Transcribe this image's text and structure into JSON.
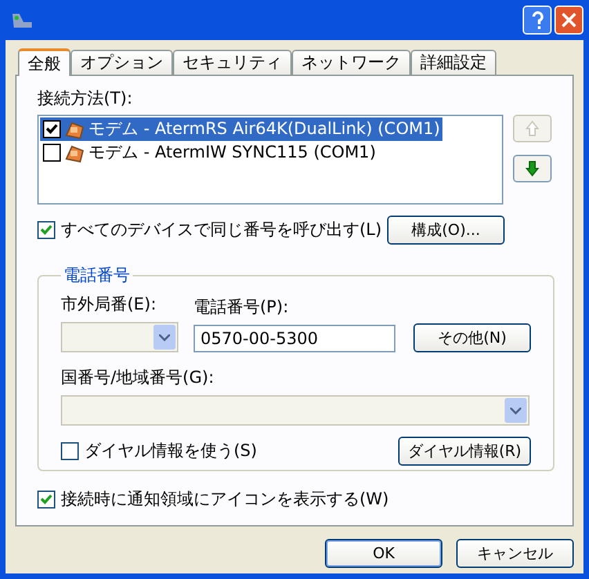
{
  "tabs": [
    {
      "label": "全般",
      "selected": true
    },
    {
      "label": "オプション",
      "selected": false
    },
    {
      "label": "セキュリティ",
      "selected": false
    },
    {
      "label": "ネットワーク",
      "selected": false
    },
    {
      "label": "詳細設定",
      "selected": false
    }
  ],
  "connection": {
    "label": "接続方法(T):",
    "devices": [
      {
        "name": "モデム - AtermRS Air64K(DualLink) (COM1)",
        "checked": true,
        "selected": true
      },
      {
        "name": "モデム - AtermIW SYNC115 (COM1)",
        "checked": false,
        "selected": false
      }
    ],
    "move_up": {
      "disabled": true
    },
    "move_down": {
      "disabled": false
    }
  },
  "same_number": {
    "label": "すべてのデバイスで同じ番号を呼び出す(L)",
    "checked": true
  },
  "configure_button": "構成(O)...",
  "phone": {
    "title": "電話番号",
    "area_code": {
      "label": "市外局番(E):",
      "disabled": true
    },
    "number": {
      "label": "電話番号(P):",
      "value": "0570-00-5300"
    },
    "other_button": "その他(N)",
    "country": {
      "label": "国番号/地域番号(G):",
      "disabled": true
    },
    "use_dialing_rules": {
      "label": "ダイヤル情報を使う(S)",
      "checked": false
    },
    "dialing_rules_button": "ダイヤル情報(R)"
  },
  "show_icon": {
    "label": "接続時に通知領域にアイコンを表示する(W)",
    "checked": true
  },
  "buttons": [
    {
      "label": "OK",
      "kind": "default"
    },
    {
      "label": "キャンセル",
      "kind": "normal"
    }
  ]
}
